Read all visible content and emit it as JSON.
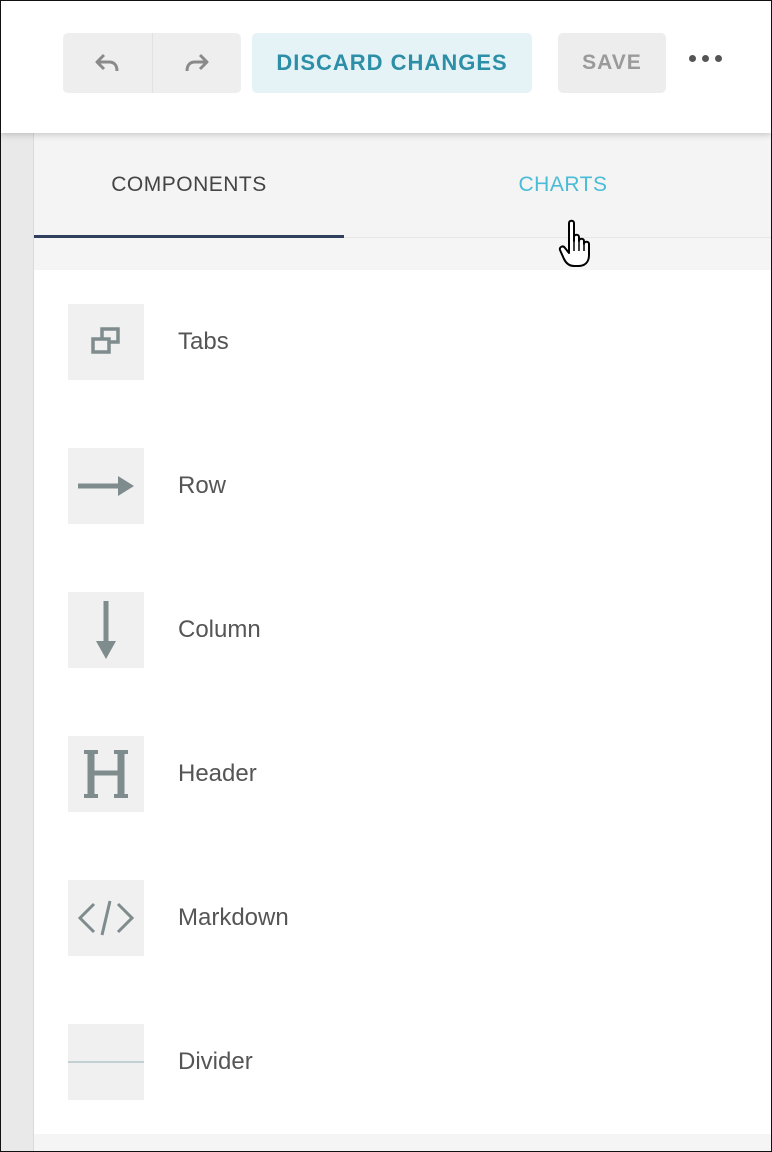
{
  "toolbar": {
    "undo_icon": "undo-icon",
    "redo_icon": "redo-icon",
    "discard_label": "DISCARD CHANGES",
    "save_label": "SAVE",
    "more_icon": "more-horizontal-icon"
  },
  "tabs": [
    {
      "label": "COMPONENTS",
      "active": true
    },
    {
      "label": "CHARTS",
      "active": false
    }
  ],
  "components": [
    {
      "label": "Tabs",
      "icon": "tabs-icon"
    },
    {
      "label": "Row",
      "icon": "arrow-right-icon"
    },
    {
      "label": "Column",
      "icon": "arrow-down-icon"
    },
    {
      "label": "Header",
      "icon": "header-icon"
    },
    {
      "label": "Markdown",
      "icon": "code-icon"
    },
    {
      "label": "Divider",
      "icon": "divider-icon"
    }
  ],
  "colors": {
    "accent": "#49bcd6",
    "discard_text": "#2c8fa7",
    "discard_bg": "#e5f3f7",
    "active_tab_underline": "#2f3f5c",
    "icon_gray": "#7f8c8d"
  }
}
